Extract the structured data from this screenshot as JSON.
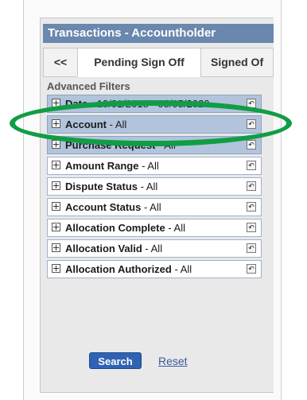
{
  "window": {
    "title": "Transactions - Accountholder"
  },
  "tabs": [
    {
      "label": "<<"
    },
    {
      "label": "Pending Sign Off"
    },
    {
      "label": "Signed Of"
    }
  ],
  "advanced": {
    "label": "Advanced Filters"
  },
  "filters": [
    {
      "label": "Date",
      "value": " - 10/01/2018 - 05/05/2020"
    },
    {
      "label": "Account",
      "value": " - All"
    },
    {
      "label": "Purchase Request",
      "value": " - All"
    },
    {
      "label": "Amount Range",
      "value": " - All"
    },
    {
      "label": "Dispute Status",
      "value": " - All"
    },
    {
      "label": "Account Status",
      "value": " - All"
    },
    {
      "label": "Allocation Complete",
      "value": " - All"
    },
    {
      "label": "Allocation Valid",
      "value": " - All"
    },
    {
      "label": "Allocation Authorized",
      "value": " - All"
    }
  ],
  "actions": {
    "search_label": "Search",
    "reset_label": "Reset"
  },
  "colors": {
    "titlebar": "#6a87ad",
    "selected_row": "#b2c4dc",
    "highlight_ellipse": "#119d45",
    "search_button": "#2f62b3"
  }
}
